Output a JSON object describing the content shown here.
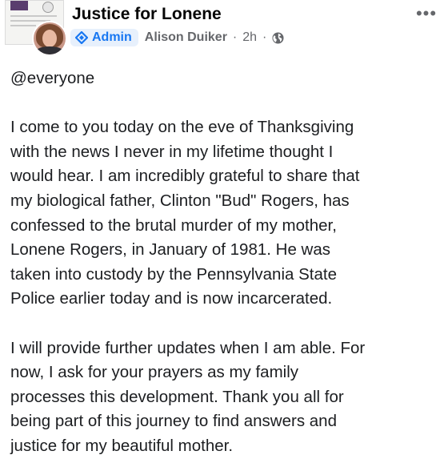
{
  "header": {
    "group_name": "Justice for Lonene",
    "role_badge": "Admin",
    "author": "Alison Duiker",
    "separator": "·",
    "time": "2h",
    "more_label": "•••",
    "icons": {
      "badge_icon": "admin-diamond-icon",
      "privacy_icon": "globe-icon",
      "more_icon": "more-options-icon"
    }
  },
  "post": {
    "mention": "@everyone",
    "paragraph_1": "I come to you today on the eve of Thanksgiving\nwith the news I never in my lifetime thought I\nwould hear. I am incredibly grateful to share that\nmy biological father, Clinton \"Bud\" Rogers, has\nconfessed to the brutal murder of my mother,\nLonene Rogers, in January of 1981. He was\ntaken into custody by the Pennsylvania State\nPolice earlier today and is now incarcerated.",
    "paragraph_2": "I will provide further updates when I am able. For\nnow, I ask for your prayers as my family\nprocesses this development. Thank you all for\nbeing part of this journey to find answers and\njustice for my beautiful mother."
  },
  "colors": {
    "badge_blue": "#1877f2",
    "badge_bg": "#e7f0fc",
    "meta_gray": "#65676b",
    "text": "#1c1e21"
  }
}
